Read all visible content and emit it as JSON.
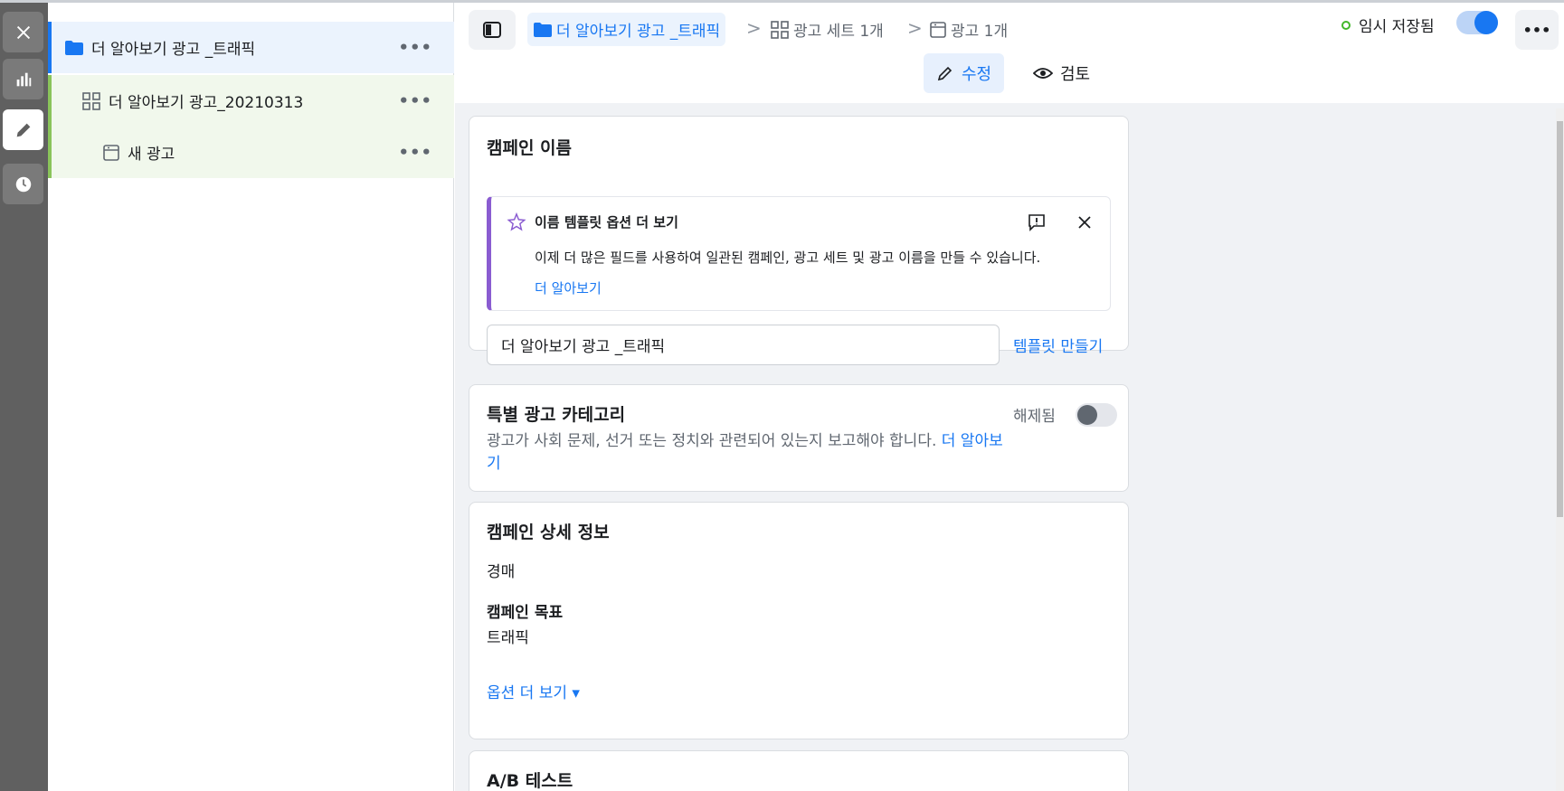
{
  "rail": {
    "items": [
      {
        "icon": "close-icon"
      },
      {
        "icon": "chart-bar-icon"
      },
      {
        "icon": "pencil-icon"
      },
      {
        "icon": "clock-icon"
      }
    ]
  },
  "tree": {
    "campaign": {
      "label": "더 알아보기 광고 _트래픽",
      "more": "•••"
    },
    "adset": {
      "label": "더 알아보기 광고_20210313",
      "more": "•••"
    },
    "ad": {
      "label": "새 광고",
      "more": "•••"
    }
  },
  "topbar": {
    "breadcrumb": {
      "campaign": "더 알아보기 광고 _트래픽",
      "adsets": "광고 세트 1개",
      "ads": "광고 1개",
      "separator": ">"
    },
    "saved_status": "임시 저장됨",
    "more": "•••",
    "modes": {
      "edit": "수정",
      "review": "검토"
    }
  },
  "campaign_name_card": {
    "title": "캠페인 이름",
    "notice": {
      "title": "이름 템플릿 옵션 더 보기",
      "body": "이제 더 많은 필드를 사용하여 일관된 캠페인, 광고 세트 및 광고 이름을 만들 수 있습니다.",
      "link": "더 알아보기"
    },
    "name_value": "더 알아보기 광고 _트래픽",
    "template_link": "템플릿 만들기"
  },
  "special_category_card": {
    "title": "특별 광고 카테고리",
    "description": "광고가 사회 문제, 선거 또는 정치와 관련되어 있는지 보고해야 합니다. ",
    "link": "더 알아보기",
    "state": "해제됨"
  },
  "campaign_details_card": {
    "title": "캠페인 상세 정보",
    "buying_type": "경매",
    "objective_label": "캠페인 목표",
    "objective_value": "트래픽",
    "more_options": "옵션 더 보기 ▾"
  },
  "ab_test_card": {
    "title": "A/B 테스트"
  },
  "colors": {
    "accent": "#1877f2",
    "campaign_row_bg": "#ebf3fd",
    "adset_row_bg": "#f1f8ec",
    "notice_accent": "#8a5cd1",
    "saved_dot": "#42b72a"
  }
}
